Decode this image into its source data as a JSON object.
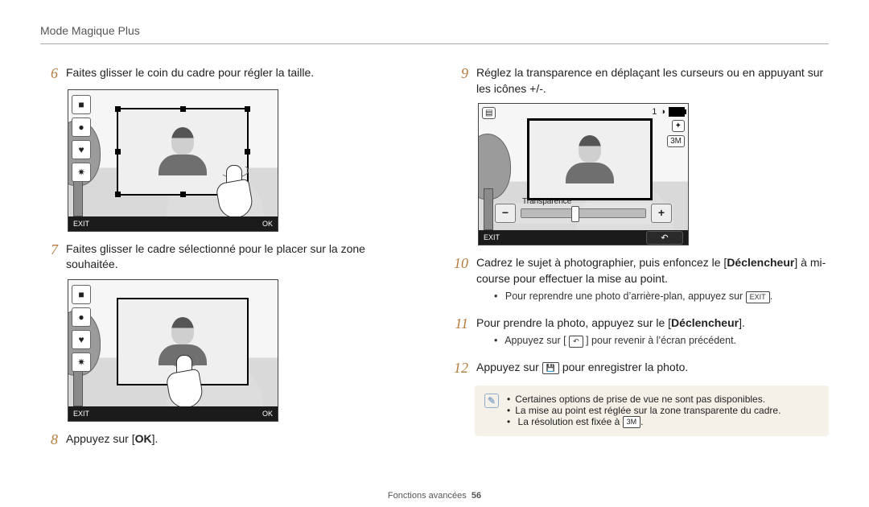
{
  "header": {
    "title": "Mode Magique Plus"
  },
  "left": {
    "step6": {
      "num": "6",
      "text": "Faites glisser le coin du cadre pour régler la taille."
    },
    "step7": {
      "num": "7",
      "text": "Faites glisser le cadre sélectionné pour le placer sur la zone souhaitée."
    },
    "step8": {
      "num": "8",
      "text_pre": "Appuyez sur [",
      "ok": "OK",
      "text_post": "]."
    }
  },
  "right": {
    "step9": {
      "num": "9",
      "text": "Réglez la transparence en déplaçant les curseurs ou en appuyant sur les icônes +/-."
    },
    "step10": {
      "num": "10",
      "text_pre": "Cadrez le sujet à photographier, puis enfoncez le [",
      "bold": "Déclencheur",
      "text_post": "] à mi-course pour effectuer la mise au point.",
      "bullet_pre": "Pour reprendre une photo d’arrière-plan, appuyez sur ",
      "bullet_chip": "EXIT",
      "bullet_post": "."
    },
    "step11": {
      "num": "11",
      "text_pre": "Pour prendre la photo, appuyez sur le [",
      "bold": "Déclencheur",
      "text_post": "].",
      "bullet_pre": "Appuyez sur [ ",
      "bullet_icon": "↶",
      "bullet_post": " ] pour revenir à l’écran précédent."
    },
    "step12": {
      "num": "12",
      "text_pre": "Appuyez sur ",
      "icon": "💾",
      "text_post": " pour enregistrer la photo."
    },
    "note": {
      "b1": "Certaines options de prise de vue ne sont pas disponibles.",
      "b2": "La mise au point est réglée sur la zone transparente du cadre.",
      "b3_pre": "La résolution est fixée à ",
      "b3_chip": "3M",
      "b3_post": "."
    }
  },
  "screens": {
    "exit": "EXIT",
    "ok": "OK",
    "transparency_label": "Transparence",
    "minus": "−",
    "plus": "+",
    "one": "1"
  },
  "footer": {
    "section": "Fonctions avancées",
    "page": "56"
  }
}
